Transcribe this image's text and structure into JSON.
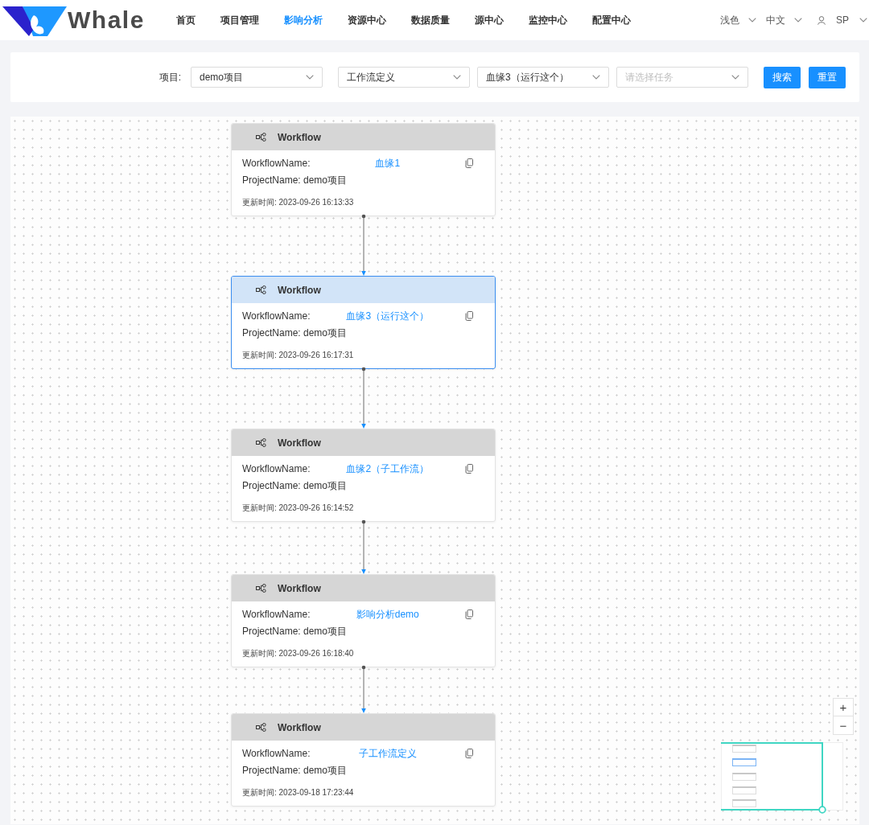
{
  "header": {
    "logo_text": "Whale",
    "nav": [
      {
        "label": "首页",
        "selected": false
      },
      {
        "label": "项目管理",
        "selected": false
      },
      {
        "label": "影响分析",
        "selected": true
      },
      {
        "label": "资源中心",
        "selected": false
      },
      {
        "label": "数据质量",
        "selected": false
      },
      {
        "label": "源中心",
        "selected": false
      },
      {
        "label": "监控中心",
        "selected": false
      },
      {
        "label": "配置中心",
        "selected": false
      }
    ],
    "theme": "浅色",
    "language": "中文",
    "user": "SP"
  },
  "filter_bar": {
    "label": "项目:",
    "selects": [
      {
        "value": "demo项目"
      },
      {
        "value": "工作流定义"
      },
      {
        "value": "血缘3（运行这个）"
      },
      {
        "placeholder": "请选择任务"
      }
    ],
    "buttons": [
      "搜索",
      "重置"
    ]
  },
  "canvas": {
    "nodes": [
      {
        "title": "Workflow",
        "name_label": "WorkflowName:",
        "name": "血缘1",
        "project": "ProjectName: demo项目",
        "updated": "更新时间: 2023-09-26 16:13:33",
        "selected": false
      },
      {
        "title": "Workflow",
        "name_label": "WorkflowName:",
        "name": "血缘3（运行这个）",
        "project": "ProjectName: demo项目",
        "updated": "更新时间: 2023-09-26 16:17:31",
        "selected": true
      },
      {
        "title": "Workflow",
        "name_label": "WorkflowName:",
        "name": "血缘2（子工作流）",
        "project": "ProjectName: demo项目",
        "updated": "更新时间: 2023-09-26 16:14:52",
        "selected": false
      },
      {
        "title": "Workflow",
        "name_label": "WorkflowName:",
        "name": "影响分析demo",
        "project": "ProjectName: demo项目",
        "updated": "更新时间: 2023-09-26 16:18:40",
        "selected": false
      },
      {
        "title": "Workflow",
        "name_label": "WorkflowName:",
        "name": "子工作流定义",
        "project": "ProjectName: demo项目",
        "updated": "更新时间: 2023-09-18 17:23:44",
        "selected": false
      }
    ],
    "zoom_controls": [
      "+",
      "−"
    ]
  }
}
